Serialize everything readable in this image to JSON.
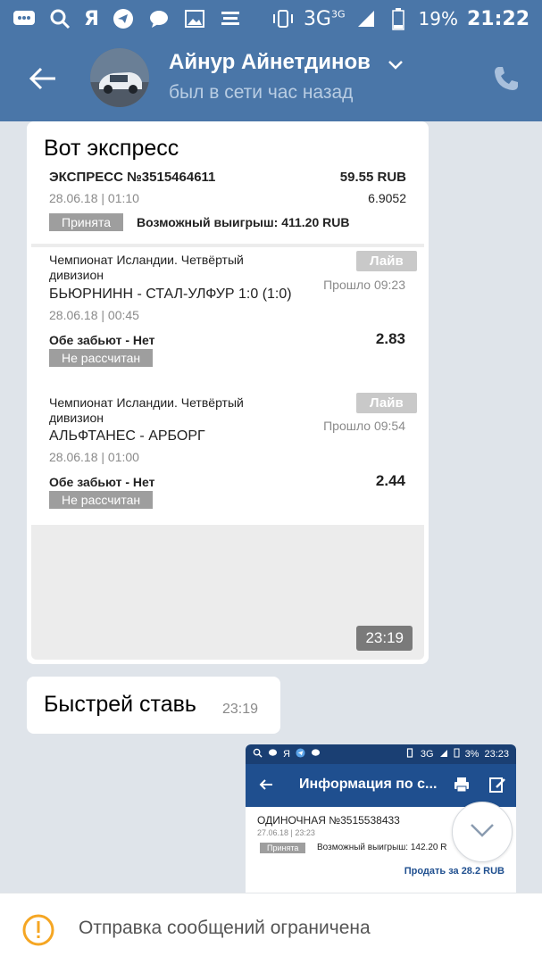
{
  "status_bar": {
    "carrier_glyph": "Я",
    "network": "3G",
    "network_sup": "3G",
    "battery_pct": "19%",
    "time": "21:22"
  },
  "header": {
    "contact_name": "Айнур Айнетдинов",
    "contact_status": "был в сети час назад"
  },
  "messages": {
    "m1": {
      "text": "Вот экспресс",
      "time": "23:19",
      "shot": {
        "express_title": "ЭКСПРЕСС №3515464611",
        "express_amount": "59.55 RUB",
        "express_date": "28.06.18 | 01:10",
        "express_coef": "6.9052",
        "accepted_badge": "Принята",
        "possible_win": "Возможный выигрыш: 411.20 RUB",
        "events": [
          {
            "league": "Чемпионат Исландии. Четвёртый дивизион",
            "live_badge": "Лайв",
            "passed": "Прошло 09:23",
            "teams": "БЬЮРНИНН - СТАЛ-УЛФУР 1:0 (1:0)",
            "date": "28.06.18 | 00:45",
            "bet": "Обе забьют - Нет",
            "odds": "2.83",
            "status": "Не рассчитан"
          },
          {
            "league": "Чемпионат Исландии. Четвёртый дивизион",
            "live_badge": "Лайв",
            "passed": "Прошло 09:54",
            "teams": "АЛЬФТАНЕС - АРБОРГ",
            "date": "28.06.18 | 01:00",
            "bet": "Обе забьют - Нет",
            "odds": "2.44",
            "status": "Не рассчитан"
          }
        ]
      }
    },
    "m2": {
      "text": "Быстрей ставь",
      "time": "23:19"
    },
    "m3": {
      "status_left_glyph": "Я",
      "status_net": "3G",
      "status_battery": "3%",
      "status_time": "23:23",
      "title": "Информация по с...",
      "single_title": "ОДИНОЧНАЯ №3515538433",
      "single_date": "27.06.18 | 23:23",
      "accepted_badge": "Принята",
      "possible_win": "Возможный выигрыш: 142.20 R",
      "sell": "Продать за 28.2 RUB"
    }
  },
  "footer": {
    "notice": "Отправка сообщений ограничена"
  },
  "colors": {
    "header_bg": "#4a76a8",
    "chat_bg": "#dfe4ea",
    "warning": "#f5a623"
  }
}
